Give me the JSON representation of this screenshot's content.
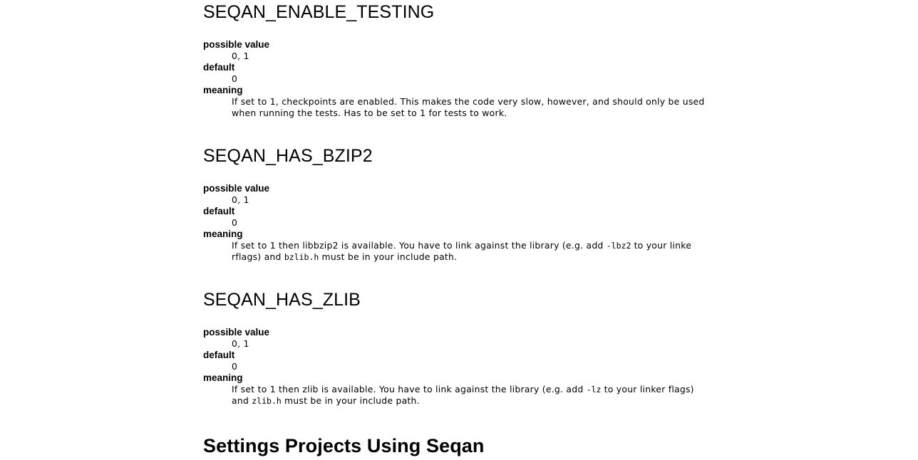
{
  "sections": [
    {
      "title": "SEQAN_ENABLE_TESTING",
      "possible_value_label": "possible value",
      "possible_value": "0, 1",
      "default_label": "default",
      "default": "0",
      "meaning_label": "meaning",
      "meaning_line1": "If set to 1, checkpoints are enabled. This makes the code very slow, however, and should only be used",
      "meaning_line2": "when running the tests. Has to be set to 1 for tests to work."
    },
    {
      "title": "SEQAN_HAS_BZIP2",
      "possible_value_label": "possible value",
      "possible_value": "0, 1",
      "default_label": "default",
      "default": "0",
      "meaning_label": "meaning",
      "meaning_a": "If set to 1 then libbzip2 is available. You have to link against the library (e.g. add ",
      "meaning_code1": "-lbz2",
      "meaning_b": " to your linke",
      "meaning_c": "rflags) and ",
      "meaning_code2": "bzlib.h",
      "meaning_d": " must be in your include path."
    },
    {
      "title": "SEQAN_HAS_ZLIB",
      "possible_value_label": "possible value",
      "possible_value": "0, 1",
      "default_label": "default",
      "default": "0",
      "meaning_label": "meaning",
      "meaning_a": "If set to 1 then zlib is available. You have to link against the library (e.g. add ",
      "meaning_code1": "-lz",
      "meaning_b": " to your linker flags)",
      "meaning_c": "and ",
      "meaning_code2": "zlib.h",
      "meaning_d": " must be in your include path."
    }
  ],
  "settings_title": "Settings Projects Using Seqan"
}
